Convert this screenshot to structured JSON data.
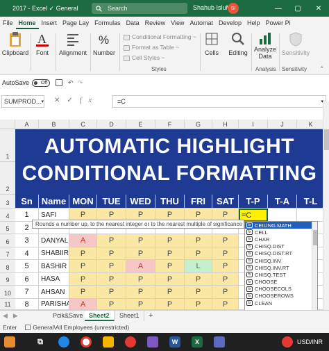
{
  "titlebar": {
    "title": "2017  -  Excel   ✓ General",
    "search_label": "Search",
    "user_name": "Shahub IsluM",
    "avatar_initials": "SI"
  },
  "menu": {
    "tabs": [
      "File",
      "Home",
      "Insert",
      "Page Lay",
      "Formulas",
      "Data",
      "Review",
      "View",
      "Automat",
      "Develop",
      "Help",
      "Power Pi"
    ],
    "active": "Home"
  },
  "ribbon": {
    "clipboard": "Clipboard",
    "font": "Font",
    "alignment": "Alignment",
    "number": "Number",
    "conditional_formatting": "Conditional Formatting ~",
    "format_as_table": "Format as Table ~",
    "cell_styles": "Cell Styles ~",
    "styles": "Styles",
    "cells": "Cells",
    "editing": "Editing",
    "analyze_data_1": "Analyze",
    "analyze_data_2": "Data",
    "sensitivity": "Sensitivity",
    "analysis": "Analysis",
    "sensitivity_group": "Sensitivity"
  },
  "autosave": {
    "label": "AutoSave",
    "state": "Off"
  },
  "formula_bar": {
    "name_box": "SUMPROD...",
    "formula": "=C"
  },
  "columns": [
    "A",
    "B",
    "C",
    "D",
    "E",
    "F",
    "G",
    "H",
    "I",
    "J",
    "K"
  ],
  "rows": [
    "1",
    "2",
    "3",
    "4",
    "5",
    "6",
    "7",
    "8",
    "9",
    "10",
    "11"
  ],
  "banner": {
    "line1": "AUTOMATIC HIGHLIGHT",
    "line2": "CONDITIONAL FORMATTING"
  },
  "table": {
    "headers": [
      "Sn",
      "Name",
      "MON",
      "TUE",
      "WED",
      "THU",
      "FRI",
      "SAT",
      "T-P",
      "T-A",
      "T-L"
    ],
    "records": [
      {
        "sn": "1",
        "name": "SAFI",
        "days": [
          "P",
          "P",
          "P",
          "P",
          "P",
          "P"
        ]
      },
      {
        "sn": "2",
        "name": "",
        "days": [
          "",
          "",
          "",
          "",
          "",
          ""
        ]
      },
      {
        "sn": "3",
        "name": "DANYAL",
        "days": [
          "A",
          "P",
          "P",
          "P",
          "P",
          "P"
        ]
      },
      {
        "sn": "4",
        "name": "SHABIIR",
        "days": [
          "P",
          "P",
          "P",
          "P",
          "P",
          "P"
        ]
      },
      {
        "sn": "5",
        "name": "BASHIR",
        "days": [
          "P",
          "P",
          "A",
          "P",
          "L",
          "P"
        ]
      },
      {
        "sn": "6",
        "name": "HASA",
        "days": [
          "P",
          "P",
          "P",
          "P",
          "P",
          "P"
        ]
      },
      {
        "sn": "7",
        "name": "AHSAN",
        "days": [
          "P",
          "P",
          "P",
          "P",
          "P",
          "P"
        ]
      },
      {
        "sn": "8",
        "name": "PARISHA",
        "days": [
          "A",
          "P",
          "P",
          "P",
          "P",
          "P"
        ]
      }
    ],
    "active_cell_text": "=C"
  },
  "tooltip": "Rounds a number up, to the nearest integer or to the nearest multiple of significance",
  "autocomplete": {
    "items": [
      "CEILING.MATH",
      "CELL",
      "CHAR",
      "CHISQ.DIST",
      "CHISQ.DIST.RT",
      "CHISQ.INV",
      "CHISQ.INV.RT",
      "CHISQ.TEST",
      "CHOOSE",
      "CHOOSECOLS",
      "CHOOSEROWS",
      "CLEAN"
    ],
    "selected": "CEILING.MATH"
  },
  "sheets": {
    "tabs": [
      "Pcik&Save",
      "Sheet2",
      "Sheet1"
    ],
    "active": "Sheet2",
    "add": "+"
  },
  "status": {
    "mode": "Enter",
    "sensitivity": "General\\All Employees (unrestricted)"
  },
  "tray": {
    "currency": "USD/INR"
  },
  "colors": {
    "excel_green": "#1d6b40",
    "banner_blue": "#1f3a93",
    "present": "#fbe7a4",
    "absent": "#f7c6c6",
    "leave": "#c6efce"
  }
}
